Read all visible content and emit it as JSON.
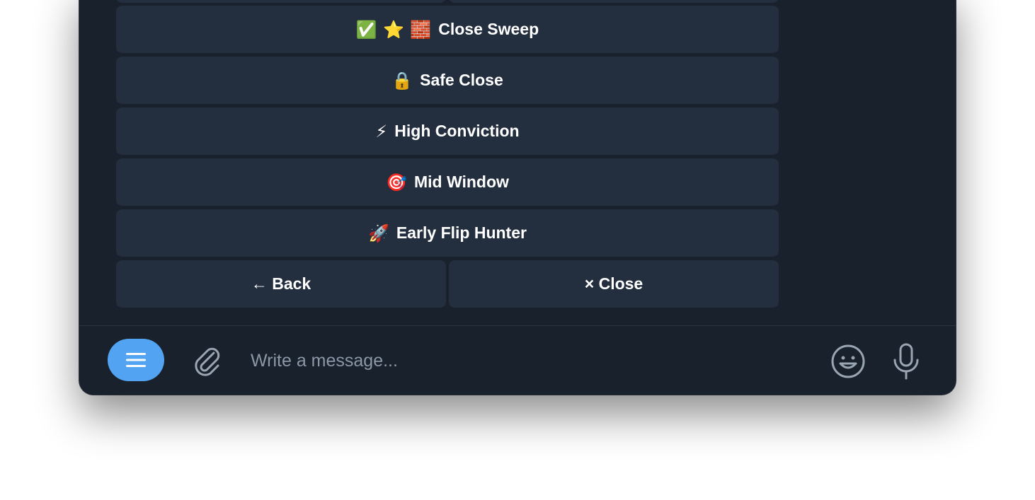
{
  "keyboard": {
    "buttons": [
      {
        "emoji": "✅ ⭐ 🧱",
        "label": "Close Sweep"
      },
      {
        "emoji": "🔒",
        "label": "Safe Close"
      },
      {
        "emoji": "⚡",
        "label": "High Conviction"
      },
      {
        "emoji": "🎯",
        "label": "Mid Window"
      },
      {
        "emoji": "🚀",
        "label": "Early Flip Hunter"
      }
    ],
    "back": {
      "label": "← Back"
    },
    "close": {
      "label": "× Close"
    }
  },
  "composer": {
    "placeholder": "Write a message..."
  },
  "colors": {
    "background": "#19212d",
    "button": "#232e3e",
    "accent": "#52a4f2",
    "icon": "#9aa5b3"
  },
  "icons": {
    "menu": "menu-icon",
    "attach": "paperclip-icon",
    "emoji": "smiley-icon",
    "mic": "microphone-icon"
  }
}
